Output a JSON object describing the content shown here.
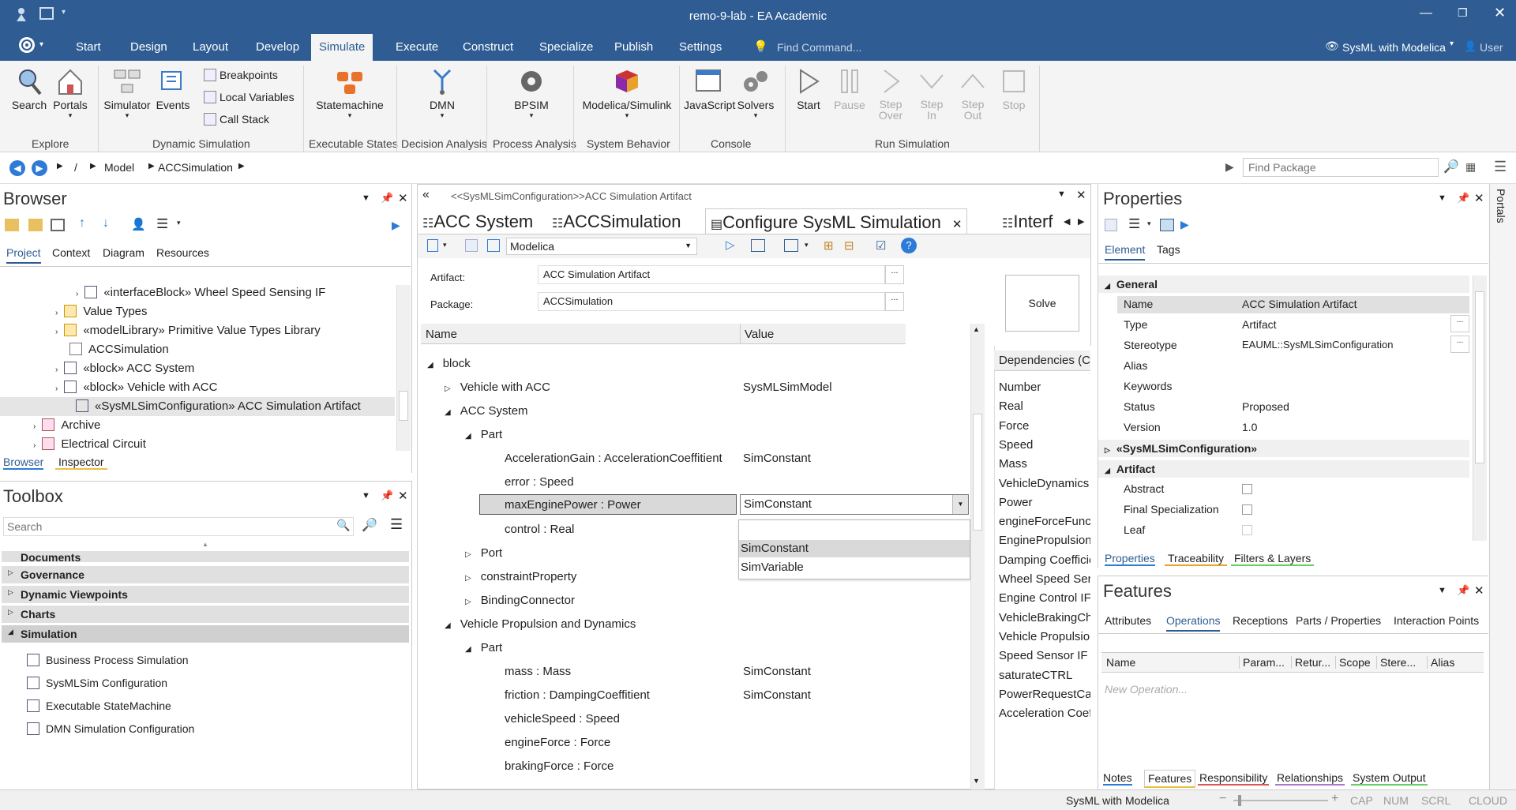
{
  "app": {
    "title": "remo-9-lab - EA Academic",
    "perspective": "SysML with Modelica",
    "user": "User"
  },
  "menu": {
    "items": [
      "Start",
      "Design",
      "Layout",
      "Develop",
      "Simulate",
      "Execute",
      "Construct",
      "Specialize",
      "Publish",
      "Settings"
    ],
    "find_placeholder": "Find Command..."
  },
  "ribbon": {
    "buttons": {
      "search": "Search",
      "portals": "Portals",
      "simulator": "Simulator",
      "events": "Events",
      "breakpoints": "Breakpoints",
      "local_vars": "Local Variables",
      "call_stack": "Call Stack",
      "statemachine": "Statemachine",
      "dmn": "DMN",
      "bpsim": "BPSIM",
      "modelica": "Modelica/Simulink",
      "javascript": "JavaScript",
      "solvers": "Solvers",
      "start": "Start",
      "pause": "Pause",
      "step_over": "Step Over",
      "step_in": "Step In",
      "step_out": "Step Out",
      "stop": "Stop"
    },
    "groups": [
      "Explore",
      "Dynamic Simulation",
      "Executable States",
      "Decision Analysis",
      "Process Analysis",
      "System Behavior",
      "Console",
      "Run Simulation"
    ]
  },
  "address": {
    "path": [
      "/",
      "Model",
      "ACCSimulation"
    ],
    "find_placeholder": "Find Package"
  },
  "browser": {
    "title": "Browser",
    "tabs": [
      "Project",
      "Context",
      "Diagram",
      "Resources"
    ],
    "tree": [
      "«interfaceBlock» Wheel Speed Sensing IF",
      "Value Types",
      "«modelLibrary» Primitive Value Types Library",
      "ACCSimulation",
      "«block» ACC System",
      "«block» Vehicle with ACC",
      "«SysMLSimConfiguration» ACC Simulation Artifact",
      "Archive",
      "Electrical Circuit"
    ],
    "bottom_tabs": [
      "Browser",
      "Inspector"
    ]
  },
  "toolbox": {
    "title": "Toolbox",
    "search_placeholder": "Search",
    "categories": [
      "Documents",
      "Governance",
      "Dynamic Viewpoints",
      "Charts",
      "Simulation"
    ],
    "items": [
      "Business Process Simulation",
      "SysMLSim Configuration",
      "Executable StateMachine",
      "DMN Simulation Configuration"
    ]
  },
  "center": {
    "breadcrumb": "<<SysMLSimConfiguration>>ACC Simulation Artifact",
    "tabs": [
      "ACC System",
      "ACCSimulation",
      "Configure SysML Simulation",
      "Interf"
    ],
    "platform": "Modelica",
    "artifact_label": "Artifact:",
    "artifact_value": "ACC Simulation Artifact",
    "package_label": "Package:",
    "package_value": "ACCSimulation",
    "solve": "Solve",
    "grid_headers": [
      "Name",
      "Value"
    ],
    "rows": [
      {
        "name": "block",
        "value": ""
      },
      {
        "name": "Vehicle with ACC",
        "value": "SysMLSimModel"
      },
      {
        "name": "ACC System",
        "value": ""
      },
      {
        "name": "Part",
        "value": ""
      },
      {
        "name": "AccelerationGain : AccelerationCoeffitient",
        "value": "SimConstant"
      },
      {
        "name": "error : Speed",
        "value": ""
      },
      {
        "name": "maxEnginePower : Power",
        "value": "SimConstant"
      },
      {
        "name": "control : Real",
        "value": ""
      },
      {
        "name": "Port",
        "value": ""
      },
      {
        "name": "constraintProperty",
        "value": ""
      },
      {
        "name": "BindingConnector",
        "value": ""
      },
      {
        "name": "Vehicle Propulsion and Dynamics",
        "value": ""
      },
      {
        "name": "Part",
        "value": ""
      },
      {
        "name": "mass : Mass",
        "value": "SimConstant"
      },
      {
        "name": "friction : DampingCoeffitient",
        "value": "SimConstant"
      },
      {
        "name": "vehicleSpeed : Speed",
        "value": ""
      },
      {
        "name": "engineForce : Force",
        "value": ""
      },
      {
        "name": "brakingForce : Force",
        "value": ""
      }
    ],
    "dropdown_options": [
      "SimConstant",
      "SimVariable"
    ],
    "deps_header": "Dependencies (Cla",
    "deps": [
      "Number",
      "Real",
      "Force",
      "Speed",
      "Mass",
      "VehicleDynamics",
      "Power",
      "engineForceFunc",
      "EnginePropulsionC",
      "Damping Coefficie",
      "Wheel Speed Sens",
      "Engine Control IF",
      "VehicleBrakingCha",
      "Vehicle Propulsion",
      "Speed Sensor IF",
      "saturateCTRL",
      "PowerRequestCalc",
      "Acceleration Coeff"
    ]
  },
  "properties": {
    "title": "Properties",
    "tabs": [
      "Element",
      "Tags"
    ],
    "section_general": "General",
    "fields": [
      {
        "label": "Name",
        "value": "ACC Simulation Artifact"
      },
      {
        "label": "Type",
        "value": "Artifact"
      },
      {
        "label": "Stereotype",
        "value": "EAUML::SysMLSimConfiguration"
      },
      {
        "label": "Alias",
        "value": ""
      },
      {
        "label": "Keywords",
        "value": ""
      },
      {
        "label": "Status",
        "value": "Proposed"
      },
      {
        "label": "Version",
        "value": "1.0"
      }
    ],
    "section_stereo": "«SysMLSimConfiguration»",
    "section_artifact": "Artifact",
    "checks": [
      "Abstract",
      "Final Specialization",
      "Leaf"
    ],
    "bottom_tabs": [
      "Properties",
      "Traceability",
      "Filters & Layers"
    ]
  },
  "features": {
    "title": "Features",
    "tabs": [
      "Attributes",
      "Operations",
      "Receptions",
      "Parts / Properties",
      "Interaction Points"
    ],
    "columns": [
      "Name",
      "Param...",
      "Retur...",
      "Scope",
      "Stere...",
      "Alias"
    ],
    "new_op": "New Operation...",
    "bottom_tabs": [
      "Notes",
      "Features",
      "Responsibility",
      "Relationships",
      "System Output"
    ]
  },
  "portals_label": "Portals",
  "status": {
    "perspective": "SysML with Modelica",
    "flags": [
      "CAP",
      "NUM",
      "SCRL",
      "CLOUD"
    ]
  }
}
